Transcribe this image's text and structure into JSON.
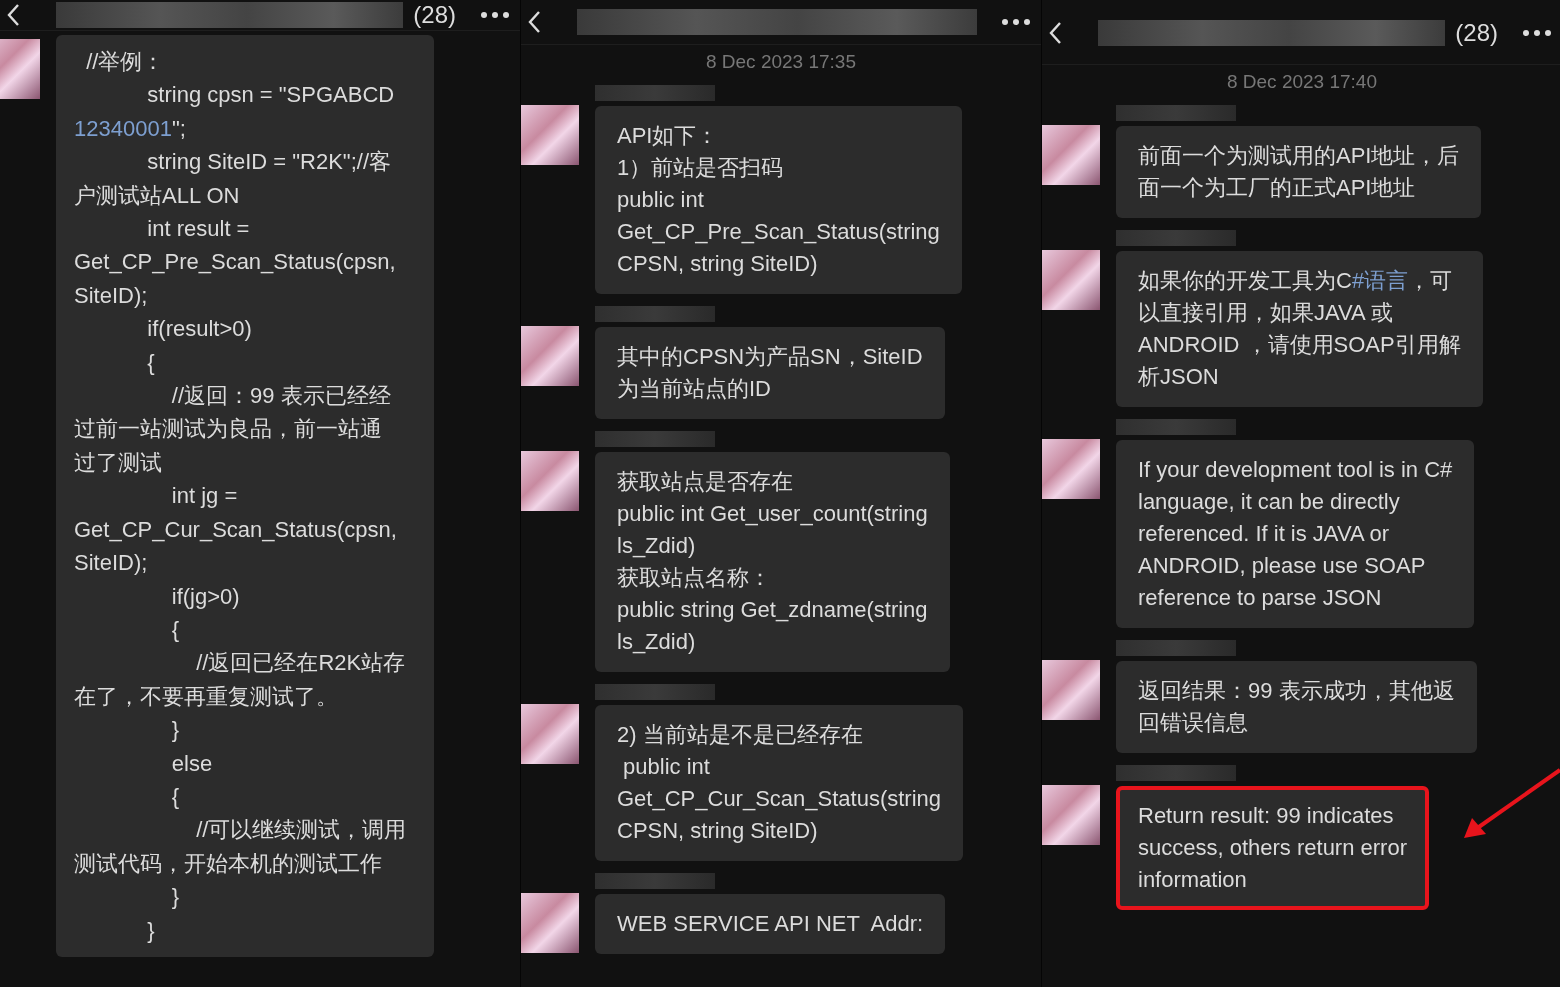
{
  "panels": [
    {
      "header": {
        "count": "(28)"
      },
      "messages": [
        {
          "lines": [
            "  //举例：",
            "            string cpsn = \"SPGABCD",
            {
              "segments": [
                {
                  "kind": "link",
                  "text": "12340001"
                },
                {
                  "kind": "plain",
                  "text": "\";"
                }
              ]
            },
            "            string SiteID = \"R2K\";//客",
            "户测试站ALL ON",
            "            int result =",
            "Get_CP_Pre_Scan_Status(cpsn,",
            "SiteID);",
            "            if(result>0)",
            "            {",
            "                //返回：99 表示已经经",
            "过前一站测试为良品，前一站通",
            "过了测试",
            "                int jg =",
            "Get_CP_Cur_Scan_Status(cpsn,",
            "SiteID);",
            "                if(jg>0)",
            "                {",
            "                    //返回已经在R2K站存",
            "在了，不要再重复测试了。",
            "                }",
            "                else",
            "                {",
            "                    //可以继续测试，调用",
            "测试代码，开始本机的测试工作",
            "                }",
            "            }"
          ]
        }
      ]
    },
    {
      "timestamp": "8 Dec 2023 17:35",
      "messages": [
        {
          "lines": [
            "API如下：",
            "1）前站是否扫码",
            "public int",
            "Get_CP_Pre_Scan_Status(string",
            "CPSN, string SiteID)"
          ]
        },
        {
          "lines": [
            "其中的CPSN为产品SN，SiteID",
            "为当前站点的ID"
          ]
        },
        {
          "lines": [
            "获取站点是否存在",
            "public int Get_user_count(string",
            "ls_Zdid)",
            "获取站点名称：",
            "public string Get_zdname(string",
            "ls_Zdid)"
          ]
        },
        {
          "lines": [
            "2) 当前站是不是已经存在",
            " public int",
            "Get_CP_Cur_Scan_Status(string",
            "CPSN, string SiteID)"
          ]
        },
        {
          "lines": [
            "WEB SERVICE API NET  Addr:"
          ]
        }
      ]
    },
    {
      "header": {
        "count": "(28)"
      },
      "timestamp": "8 Dec 2023 17:40",
      "messages": [
        {
          "highlighted": false,
          "lines": [
            "前面一个为测试用的API地址，后",
            "面一个为工厂的正式API地址"
          ]
        },
        {
          "highlighted": false,
          "lines": [
            {
              "segments": [
                {
                  "kind": "plain",
                  "text": "如果你的开发工具为C"
                },
                {
                  "kind": "link",
                  "text": "#语言"
                },
                {
                  "kind": "plain",
                  "text": "，可"
                }
              ]
            },
            "以直接引用，如果JAVA 或",
            "ANDROID ，请使用SOAP引用解",
            "析JSON"
          ]
        },
        {
          "highlighted": false,
          "lines": [
            "If your development tool is in C#",
            "language, it can be directly",
            "referenced. If it is JAVA or",
            "ANDROID, please use SOAP",
            "reference to parse JSON"
          ]
        },
        {
          "highlighted": false,
          "lines": [
            "返回结果：99 表示成功，其他返",
            "回错误信息"
          ]
        },
        {
          "highlighted": true,
          "lines": [
            "Return result: 99 indicates",
            "success, others return error",
            "information"
          ]
        }
      ]
    }
  ]
}
